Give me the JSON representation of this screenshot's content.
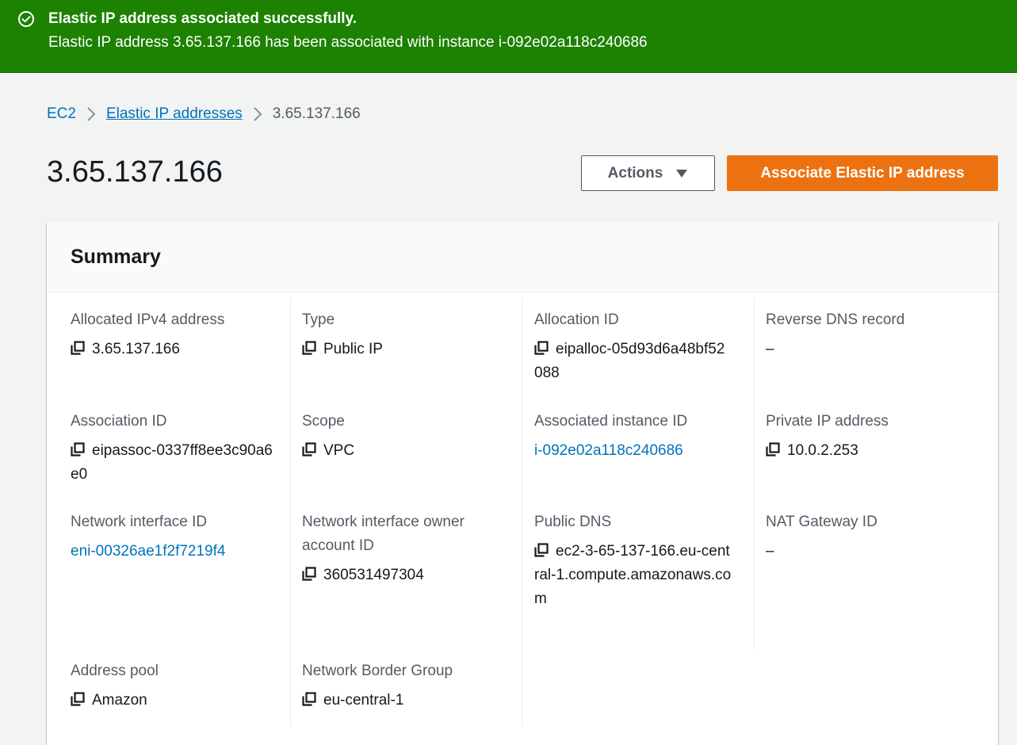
{
  "flash": {
    "status_color": "#1d8102",
    "icon": "check-circle-icon",
    "title": "Elastic IP address associated successfully.",
    "message": "Elastic IP address 3.65.137.166 has been associated with instance i-092e02a118c240686"
  },
  "breadcrumb": {
    "items": [
      "EC2",
      "Elastic IP addresses",
      "3.65.137.166"
    ]
  },
  "header": {
    "title": "3.65.137.166",
    "actions_label": "Actions",
    "primary_label": "Associate Elastic IP address",
    "primary_color": "#ec7211"
  },
  "summary": {
    "title": "Summary",
    "fields": [
      {
        "label": "Allocated IPv4 address",
        "value": "3.65.137.166",
        "copy": true,
        "link": false
      },
      {
        "label": "Type",
        "value": "Public IP",
        "copy": true,
        "link": false
      },
      {
        "label": "Allocation ID",
        "value": "eipalloc-05d93d6a48bf52088",
        "copy": true,
        "link": false
      },
      {
        "label": "Reverse DNS record",
        "value": "–",
        "copy": false,
        "link": false
      },
      {
        "label": "Association ID",
        "value": "eipassoc-0337ff8ee3c90a6e0",
        "copy": true,
        "link": false
      },
      {
        "label": "Scope",
        "value": "VPC",
        "copy": true,
        "link": false
      },
      {
        "label": "Associated instance ID",
        "value": "i-092e02a118c240686",
        "copy": false,
        "link": true
      },
      {
        "label": "Private IP address",
        "value": "10.0.2.253",
        "copy": true,
        "link": false
      },
      {
        "label": "Network interface ID",
        "value": "eni-00326ae1f2f7219f4",
        "copy": false,
        "link": true
      },
      {
        "label": "Network interface owner account ID",
        "value": "360531497304",
        "copy": true,
        "link": false
      },
      {
        "label": "Public DNS",
        "value": "ec2-3-65-137-166.eu-central-1.compute.amazonaws.com",
        "copy": true,
        "link": false
      },
      {
        "label": "NAT Gateway ID",
        "value": "–",
        "copy": false,
        "link": false
      },
      {
        "label": "Address pool",
        "value": "Amazon",
        "copy": true,
        "link": false
      },
      {
        "label": "Network Border Group",
        "value": "eu-central-1",
        "copy": true,
        "link": false
      }
    ]
  }
}
